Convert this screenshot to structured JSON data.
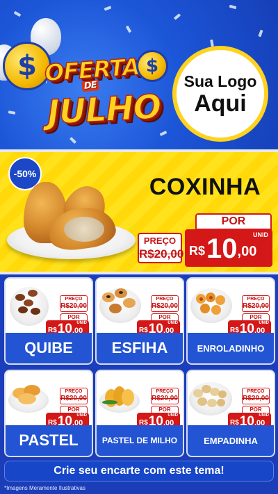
{
  "header": {
    "title_top": "OFERTAS",
    "title_de": "DE",
    "title_bottom": "JULHO",
    "coin_symbol": "$",
    "logo_line1": "Sua Logo",
    "logo_line2": "Aqui"
  },
  "featured": {
    "discount_badge": "-50%",
    "name": "COXINHA",
    "preco_label": "PREÇO",
    "old_price": "R$20,00",
    "por_label": "POR",
    "currency": "R$",
    "price_int": "10",
    "price_dec": ",00",
    "unit": "UNID"
  },
  "products": [
    {
      "name": "QUIBE",
      "preco_label": "PREÇO",
      "old_price": "R$20,00",
      "por_label": "POR",
      "currency": "R$",
      "price_int": "10",
      "price_dec": ",00",
      "unit": "UNID"
    },
    {
      "name": "ESFIHA",
      "preco_label": "PREÇO",
      "old_price": "R$20,00",
      "por_label": "POR",
      "currency": "R$",
      "price_int": "10",
      "price_dec": ",00",
      "unit": "UNID"
    },
    {
      "name": "ENROLADINHO",
      "preco_label": "PREÇO",
      "old_price": "R$20,00",
      "por_label": "POR",
      "currency": "R$",
      "price_int": "10",
      "price_dec": ",00",
      "unit": "UNID"
    },
    {
      "name": "PASTEL",
      "preco_label": "PREÇO",
      "old_price": "R$20,00",
      "por_label": "POR",
      "currency": "R$",
      "price_int": "10",
      "price_dec": ",00",
      "unit": "UNID"
    },
    {
      "name": "PASTEL DE MILHO",
      "preco_label": "PREÇO",
      "old_price": "R$20,00",
      "por_label": "POR",
      "currency": "R$",
      "price_int": "10",
      "price_dec": ",00",
      "unit": "UNID"
    },
    {
      "name": "EMPADINHA",
      "preco_label": "PREÇO",
      "old_price": "R$20,00",
      "por_label": "POR",
      "currency": "R$",
      "price_int": "10",
      "price_dec": ",00",
      "unit": "UNID"
    }
  ],
  "cta_label": "Crie seu encarte com este tema!",
  "disclaimer": "*Imagens Meramente Ilustrativas",
  "colors": {
    "background_blue": "#1a3fc0",
    "featured_yellow": "#ffe21c",
    "price_red": "#d41717",
    "title_gold": "#ffd21f",
    "card_blue": "#2354d4"
  }
}
